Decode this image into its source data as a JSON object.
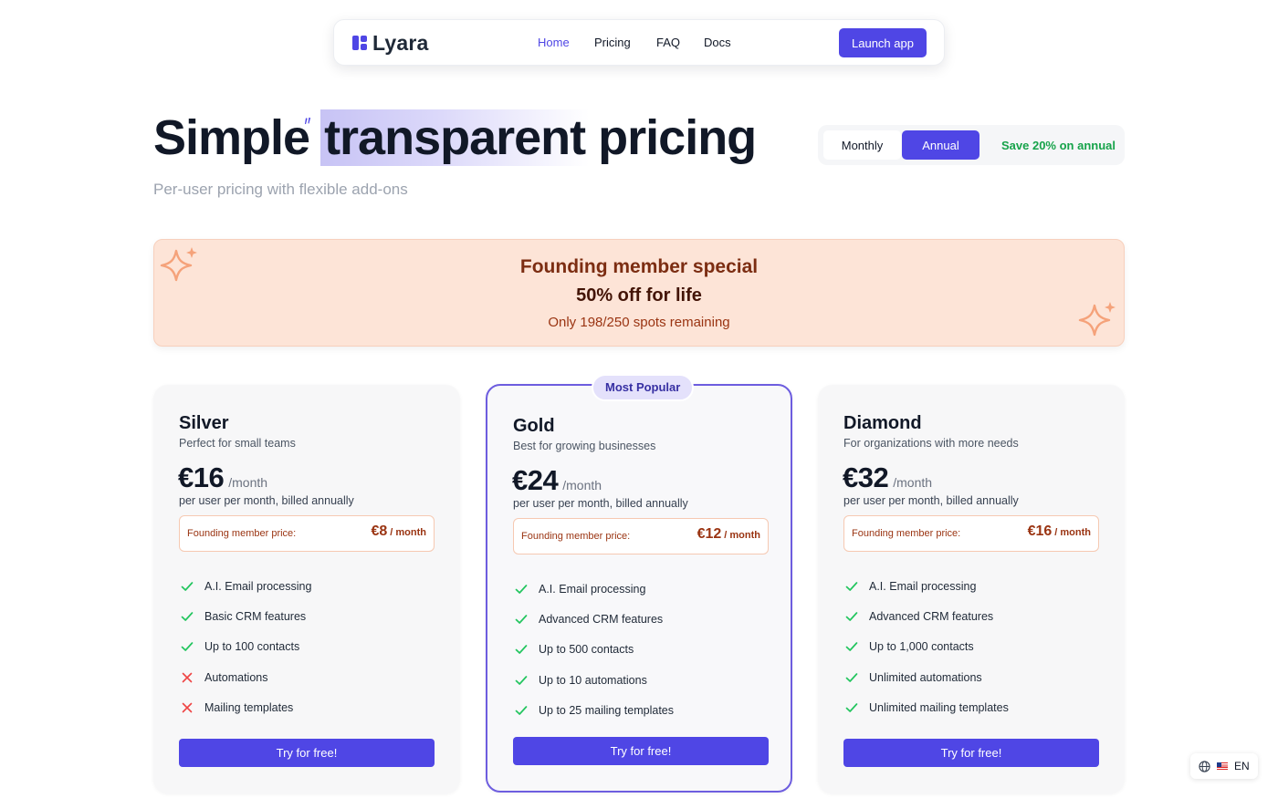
{
  "brand": {
    "name": "Lyara",
    "accent": "#4f46e5"
  },
  "nav": {
    "links": [
      {
        "label": "Home",
        "active": true
      },
      {
        "label": "Pricing",
        "active": false
      },
      {
        "label": "FAQ",
        "active": false
      },
      {
        "label": "Docs",
        "active": false
      }
    ],
    "cta": "Launch app"
  },
  "hero": {
    "title_start": "Simple",
    "title_highlight": "transparent",
    "title_end": "pricing",
    "subtitle": "Per-user pricing with flexible add-ons"
  },
  "billing": {
    "options": [
      "Monthly",
      "Annual"
    ],
    "selected": "Annual",
    "save_note": "Save 20% on annual"
  },
  "promo": {
    "title": "Founding member special",
    "subtitle": "50% off for life",
    "note": "Only 198/250 spots remaining"
  },
  "plans": [
    {
      "name": "Silver",
      "description": "Perfect for small teams",
      "price": "€16",
      "period": "/month",
      "billing_note": "per user per month, billed annually",
      "founding_label": "Founding member price:",
      "founding_price": "€8",
      "founding_unit": "/ month",
      "features": [
        {
          "text": "A.I. Email processing",
          "included": true
        },
        {
          "text": "Basic CRM features",
          "included": true
        },
        {
          "text": "Up to 100 contacts",
          "included": true
        },
        {
          "text": "Automations",
          "included": false
        },
        {
          "text": "Mailing templates",
          "included": false
        }
      ],
      "cta": "Try for free!"
    },
    {
      "name": "Gold",
      "badge": "Most Popular",
      "description": "Best for growing businesses",
      "price": "€24",
      "period": "/month",
      "billing_note": "per user per month, billed annually",
      "founding_label": "Founding member price:",
      "founding_price": "€12",
      "founding_unit": "/ month",
      "features": [
        {
          "text": "A.I. Email processing",
          "included": true
        },
        {
          "text": "Advanced CRM features",
          "included": true
        },
        {
          "text": "Up to 500 contacts",
          "included": true
        },
        {
          "text": "Up to 10 automations",
          "included": true
        },
        {
          "text": "Up to 25 mailing templates",
          "included": true
        }
      ],
      "cta": "Try for free!"
    },
    {
      "name": "Diamond",
      "description": "For organizations with more needs",
      "price": "€32",
      "period": "/month",
      "billing_note": "per user per month, billed annually",
      "founding_label": "Founding member price:",
      "founding_price": "€16",
      "founding_unit": "/ month",
      "features": [
        {
          "text": "A.I. Email processing",
          "included": true
        },
        {
          "text": "Advanced CRM features",
          "included": true
        },
        {
          "text": "Up to 1,000 contacts",
          "included": true
        },
        {
          "text": "Unlimited automations",
          "included": true
        },
        {
          "text": "Unlimited mailing templates",
          "included": true
        }
      ],
      "cta": "Try for free!"
    }
  ],
  "language": {
    "label": "EN",
    "icons": [
      "globe-icon",
      "us-flag-icon"
    ]
  },
  "colors": {
    "accent": "#4f46e5",
    "check": "#22c55e",
    "cross": "#ef4444",
    "promo_bg": "#fde4d7",
    "promo_text": "#7c2d12",
    "save_green": "#16a34a"
  }
}
